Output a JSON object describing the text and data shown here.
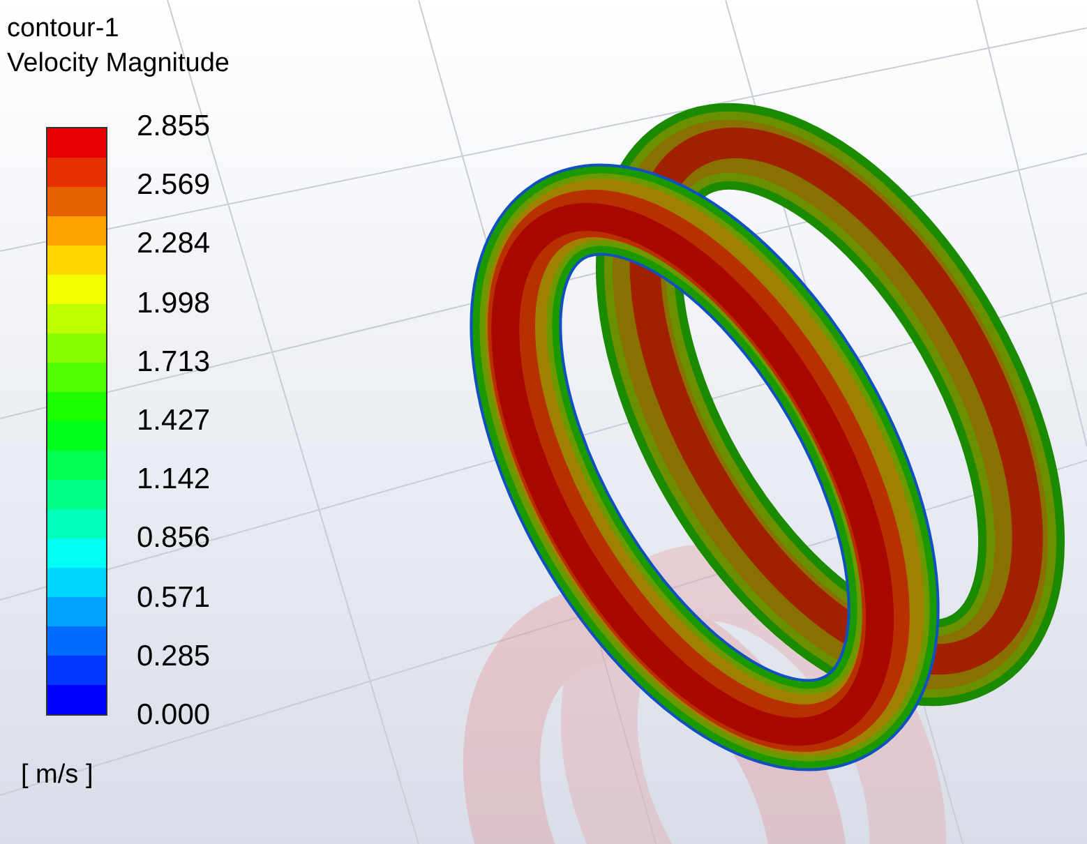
{
  "legend": {
    "title": "contour-1",
    "quantity": "Velocity Magnitude",
    "tick_labels": [
      "2.855",
      "2.569",
      "2.284",
      "1.998",
      "1.713",
      "1.427",
      "1.142",
      "0.856",
      "0.571",
      "0.285",
      "0.000"
    ],
    "units": "[ m/s ]"
  }
}
